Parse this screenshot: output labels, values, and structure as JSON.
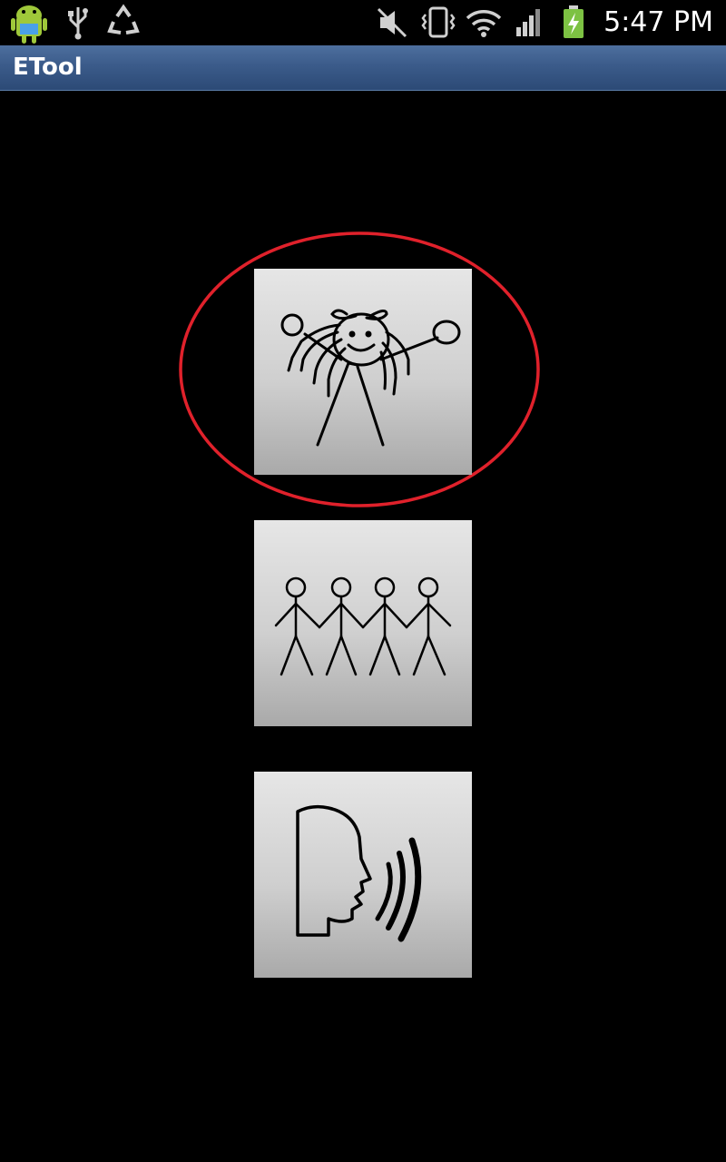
{
  "status_bar": {
    "time": "5:47 PM",
    "icons": [
      "android-notification-icon",
      "usb-icon",
      "recycle-icon",
      "mute-icon",
      "vibrate-icon",
      "wifi-icon",
      "signal-icon",
      "battery-charging-icon"
    ]
  },
  "app": {
    "title": "ETool"
  },
  "tiles": [
    {
      "icon": "girl-stick-figure-icon"
    },
    {
      "icon": "group-of-people-icon"
    },
    {
      "icon": "speaking-head-icon"
    }
  ],
  "colors": {
    "title_bar": "#3b5b8a",
    "highlight_ring": "#e0212b",
    "tile_light": "#e6e6e6",
    "tile_dark": "#a9a9a9",
    "battery": "#7dc243"
  }
}
